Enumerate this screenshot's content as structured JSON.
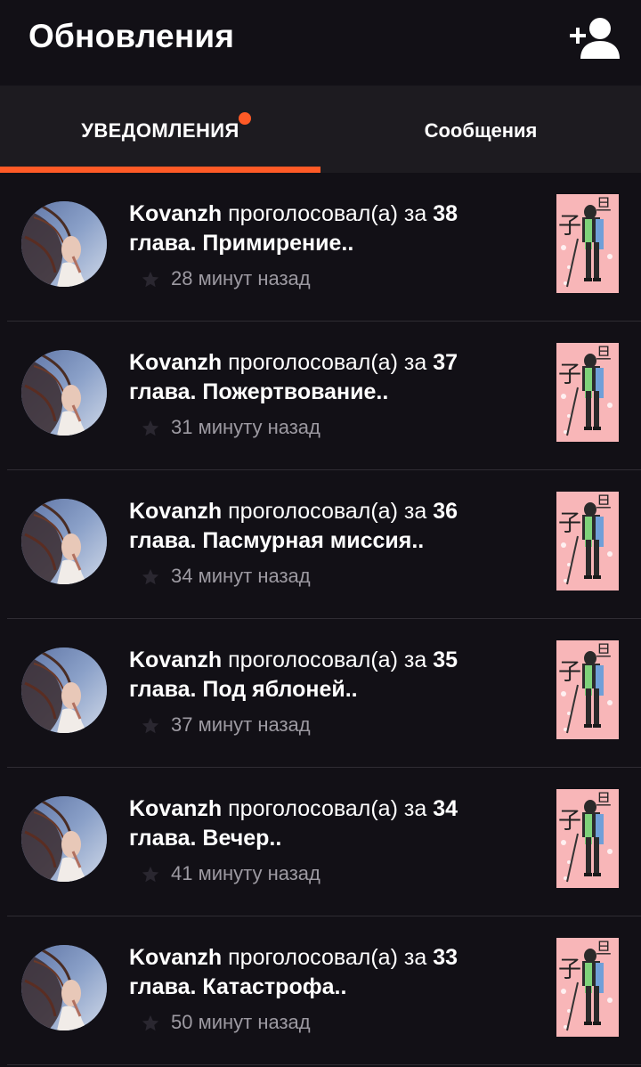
{
  "header": {
    "title": "Обновления",
    "add_user_icon": "add-user-icon"
  },
  "tabs": [
    {
      "label": "УВЕДОМЛЕНИЯ",
      "active": true,
      "has_badge": true
    },
    {
      "label": "Сообщения",
      "active": false,
      "has_badge": false
    }
  ],
  "colors": {
    "accent": "#ff5a26",
    "background": "#121016",
    "tabbar": "#1d1b20",
    "muted_text": "#9d9aa2"
  },
  "notifications": [
    {
      "user": "Kovanzh",
      "action": "проголосовал(а) за",
      "number": "38",
      "line2": "глава. Примирение..",
      "time": "28 минут назад"
    },
    {
      "user": "Kovanzh",
      "action": "проголосовал(а) за",
      "number": "37",
      "line2": "глава. Пожертвование..",
      "time": "31 минуту назад"
    },
    {
      "user": "Kovanzh",
      "action": "проголосовал(а) за",
      "number": "36",
      "line2": "глава. Пасмурная миссия..",
      "time": "34 минут назад"
    },
    {
      "user": "Kovanzh",
      "action": "проголосовал(а) за",
      "number": "35",
      "line2": "глава. Под яблоней..",
      "time": "37 минут назад"
    },
    {
      "user": "Kovanzh",
      "action": "проголосовал(а) за",
      "number": "34",
      "line2": "глава. Вечер..",
      "time": "41 минуту назад"
    },
    {
      "user": "Kovanzh",
      "action": "проголосовал(а) за",
      "number": "33",
      "line2": "глава. Катастрофа..",
      "time": "50 минут назад"
    }
  ]
}
